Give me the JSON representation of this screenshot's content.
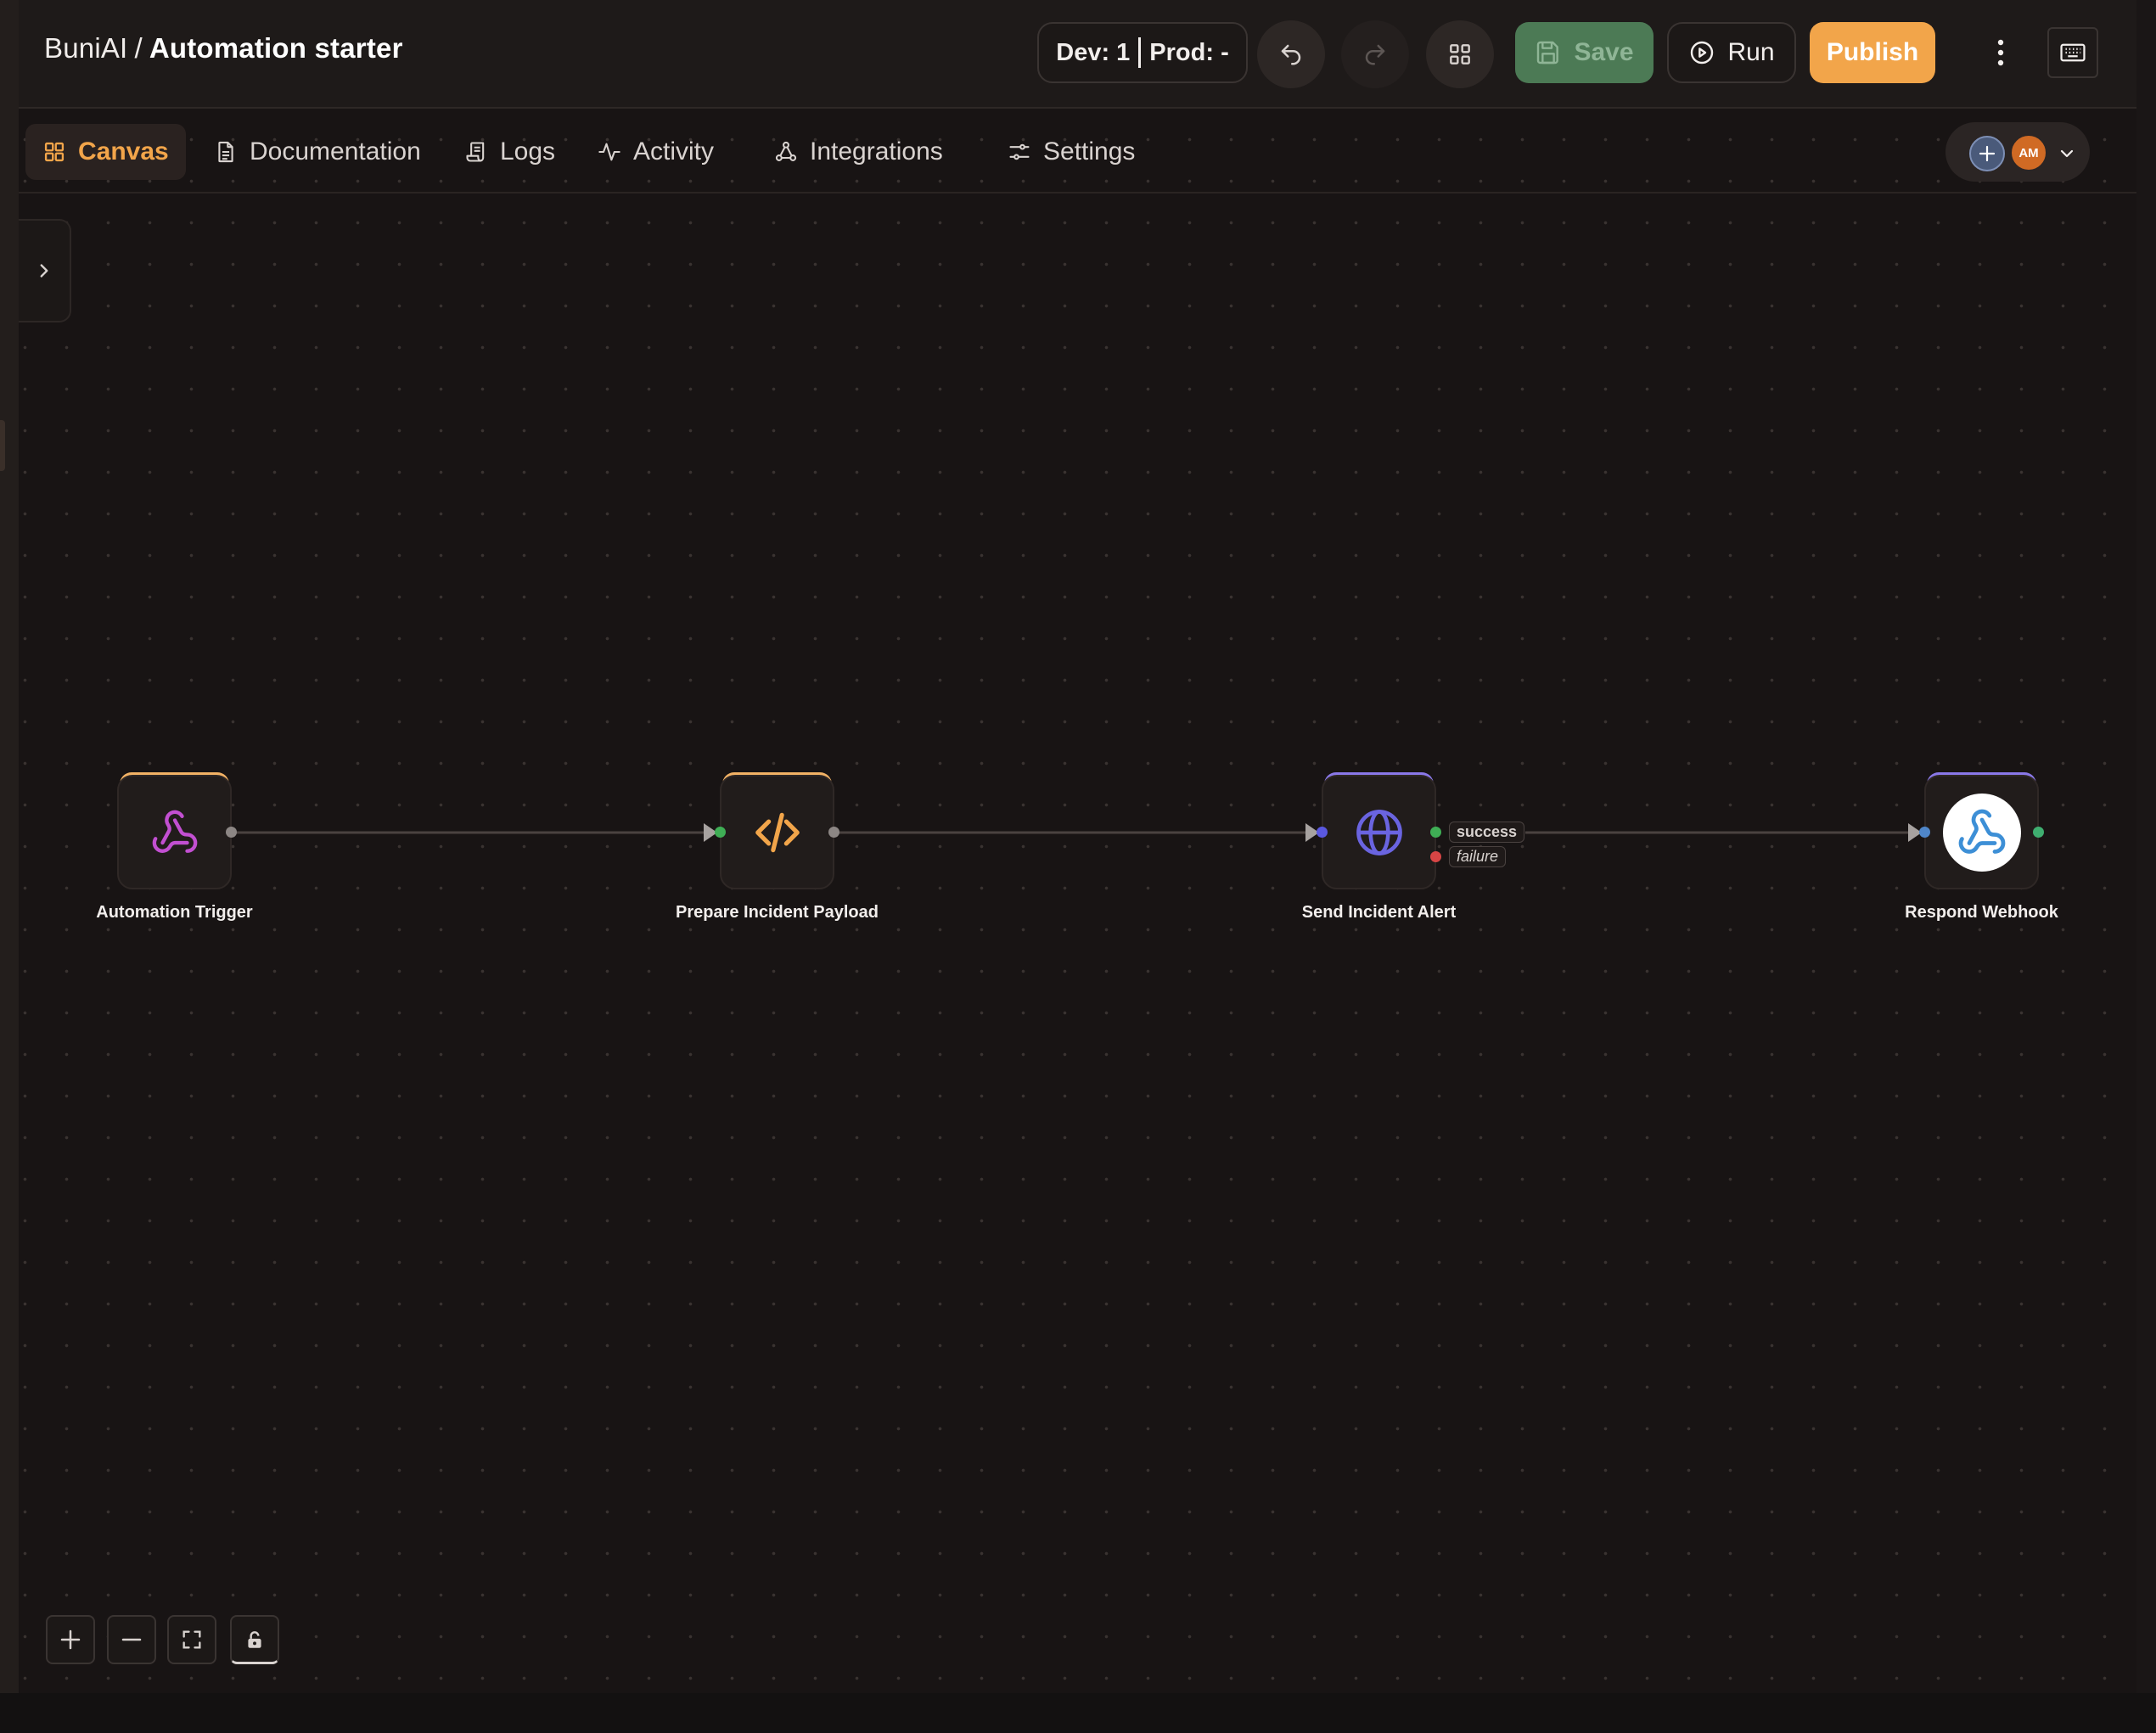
{
  "header": {
    "org": "BuniAI",
    "separator": "/",
    "workflow_name": "Automation starter",
    "env_dev": "Dev: 1",
    "env_prod": "Prod: -",
    "save_label": "Save",
    "run_label": "Run",
    "publish_label": "Publish"
  },
  "tabs": [
    {
      "label": "Canvas",
      "icon": "grid-icon",
      "active": true
    },
    {
      "label": "Documentation",
      "icon": "document-icon"
    },
    {
      "label": "Logs",
      "icon": "scroll-icon"
    },
    {
      "label": "Activity",
      "icon": "pulse-icon"
    },
    {
      "label": "Integrations",
      "icon": "nodes-icon"
    },
    {
      "label": "Settings",
      "icon": "sliders-icon"
    }
  ],
  "user": {
    "initials": "AM",
    "avatar_color": "#d06a24"
  },
  "nodes": [
    {
      "label": "Automation Trigger",
      "icon": "webhook-icon",
      "accent": "#f2b265",
      "icon_color": "#c24fd1"
    },
    {
      "label": "Prepare Incident Payload",
      "icon": "code-icon",
      "accent": "#f2b265",
      "icon_color": "#f2a54a"
    },
    {
      "label": "Send Incident Alert",
      "icon": "globe-icon",
      "accent": "#8a78e8",
      "icon_color": "#6a64e0"
    },
    {
      "label": "Respond Webhook",
      "icon": "webhook-icon",
      "accent": "#8a78e8",
      "icon_color": "#3d8fd6"
    }
  ],
  "branch_tags": {
    "success": "success",
    "failure": "failure"
  },
  "colors": {
    "accent_orange": "#f2a54a",
    "save_green": "#4c7a55",
    "handle_success": "#3fae55",
    "handle_failure": "#d84545"
  },
  "zoom_controls": [
    "plus-icon",
    "minus-icon",
    "fit-view-icon",
    "lock-icon"
  ]
}
